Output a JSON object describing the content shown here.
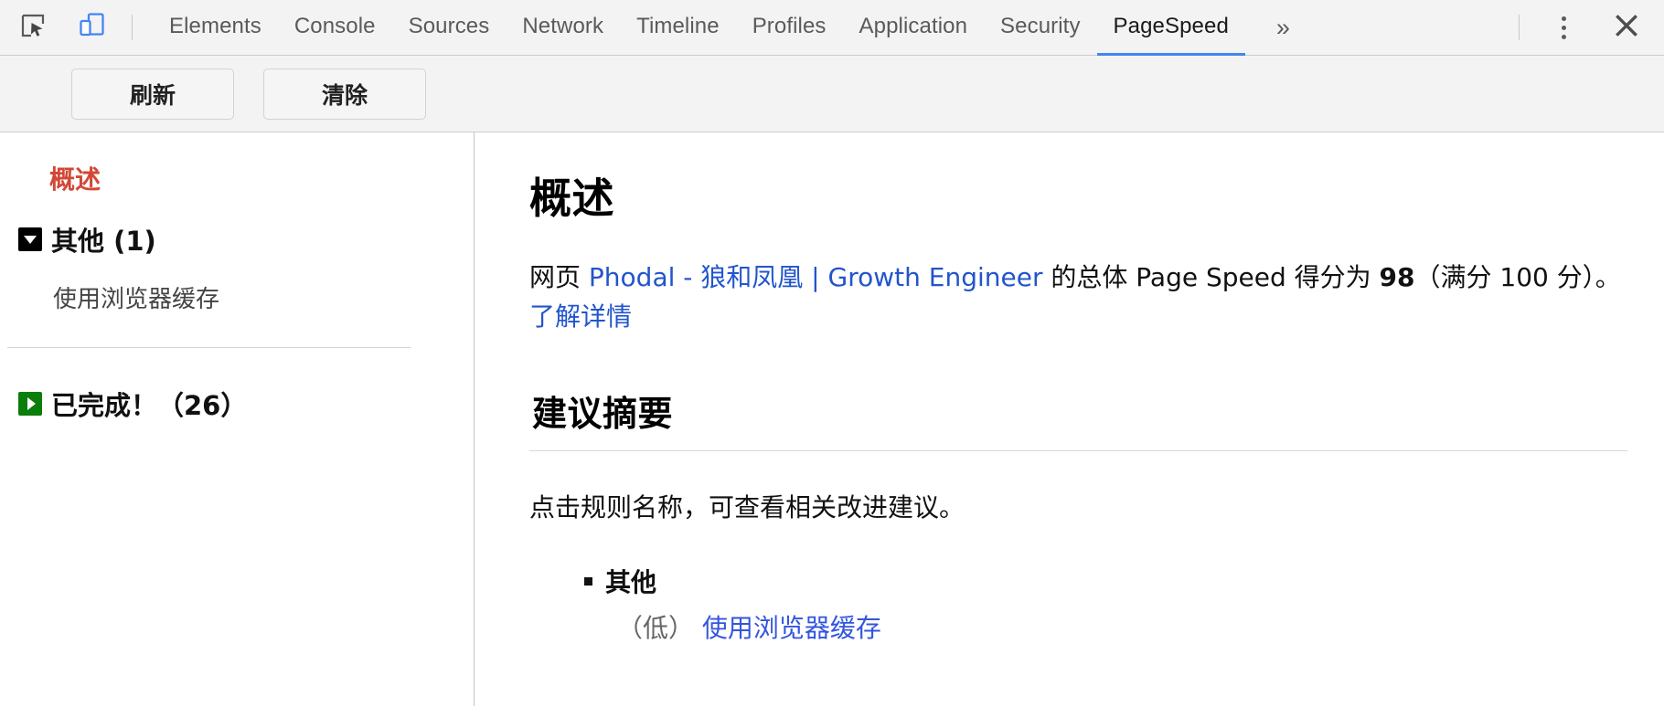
{
  "toolbar": {
    "inspect_icon": "inspect-element-icon",
    "device_icon": "device-toolbar-icon",
    "tabs": [
      {
        "label": "Elements",
        "active": false
      },
      {
        "label": "Console",
        "active": false
      },
      {
        "label": "Sources",
        "active": false
      },
      {
        "label": "Network",
        "active": false
      },
      {
        "label": "Timeline",
        "active": false
      },
      {
        "label": "Profiles",
        "active": false
      },
      {
        "label": "Application",
        "active": false
      },
      {
        "label": "Security",
        "active": false
      },
      {
        "label": "PageSpeed",
        "active": true
      }
    ],
    "overflow_label": "»",
    "more_icon": "kebab-menu-icon",
    "close_icon": "close-icon",
    "accent_color": "#4285f4"
  },
  "actions": {
    "refresh_label": "刷新",
    "clear_label": "清除"
  },
  "sidebar": {
    "overview_label": "概述",
    "overview_color": "#d14836",
    "groups": [
      {
        "label": "其他 (1)",
        "expanded": true,
        "toggle_icon": "triangle-down-icon",
        "toggle_color": "#000000",
        "children": [
          "使用浏览器缓存"
        ]
      },
      {
        "label": "已完成！（26）",
        "expanded": false,
        "toggle_icon": "triangle-right-icon",
        "toggle_color": "#0a7d0a",
        "children": []
      }
    ]
  },
  "main": {
    "title": "概述",
    "paragraph": {
      "prefix": "网页 ",
      "page_link": "Phodal - 狼和凤凰 | Growth Engineer",
      "middle": " 的总体 Page Speed 得分为 ",
      "score": "98",
      "suffix": "（满分 100 分）。 ",
      "learn_more_link": "了解详情"
    },
    "summary_heading": "建议摘要",
    "hint": "点击规则名称，可查看相关改进建议。",
    "rules": [
      {
        "category": "其他",
        "entries": [
          {
            "impact": "（低）",
            "name": "使用浏览器缓存"
          }
        ]
      }
    ],
    "link_color": "#2255cc"
  }
}
